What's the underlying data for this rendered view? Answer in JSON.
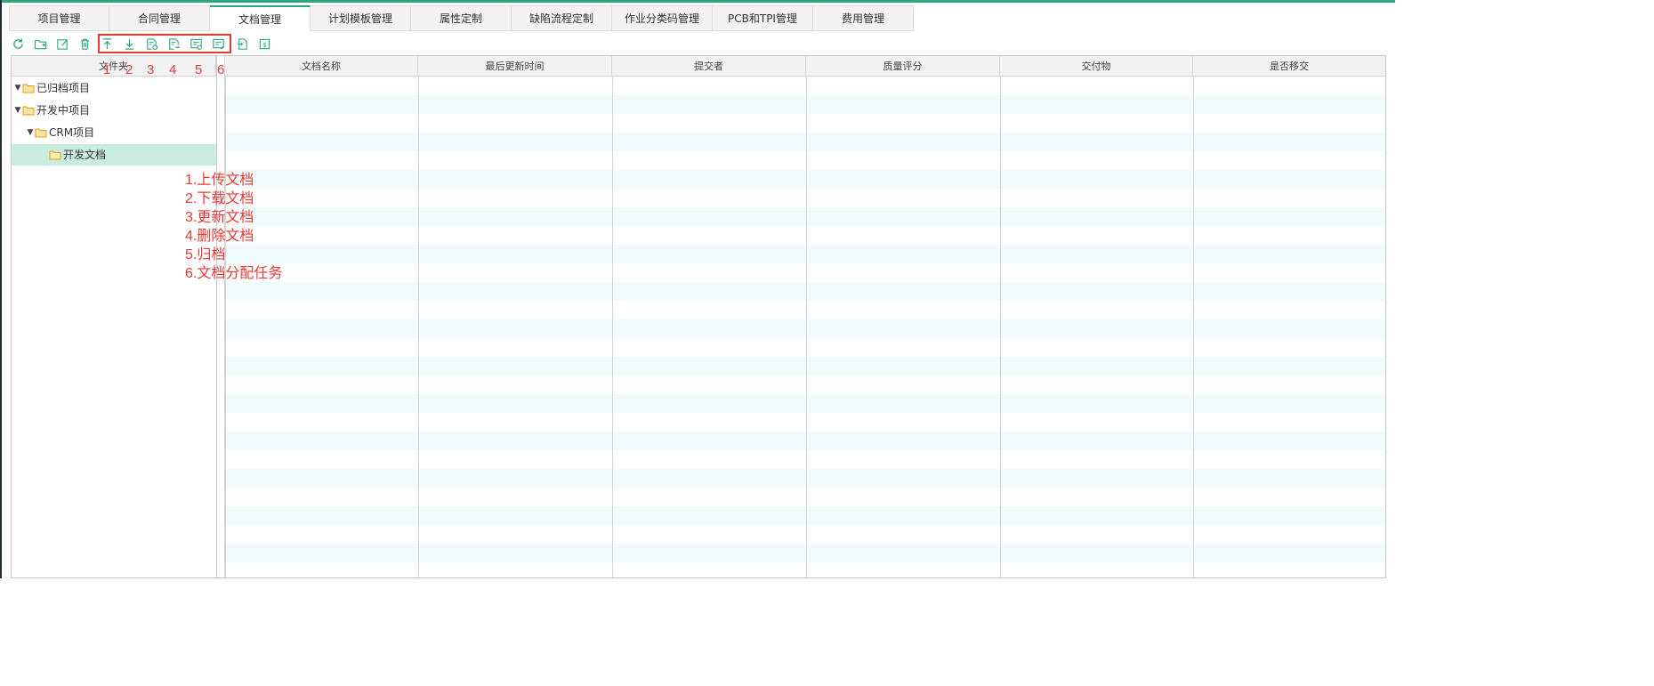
{
  "tabs": [
    {
      "label": "项目管理"
    },
    {
      "label": "合同管理"
    },
    {
      "label": "文档管理",
      "active": true
    },
    {
      "label": "计划模板管理"
    },
    {
      "label": "属性定制"
    },
    {
      "label": "缺陷流程定制"
    },
    {
      "label": "作业分类码管理"
    },
    {
      "label": "PCB和TPI管理"
    },
    {
      "label": "费用管理"
    }
  ],
  "toolbar_icons": [
    "refresh-icon",
    "add-folder-icon",
    "edit-icon",
    "delete-icon",
    "upload-icon",
    "download-icon",
    "update-doc-icon",
    "remove-doc-icon",
    "archive-icon",
    "assign-task-icon",
    "export-icon",
    "cost-icon"
  ],
  "tree": {
    "header": "文件夹",
    "nodes": [
      {
        "label": "已归档项目",
        "level": 0,
        "expanded": true
      },
      {
        "label": "开发中项目",
        "level": 0,
        "expanded": true
      },
      {
        "label": "CRM项目",
        "level": 1,
        "expanded": true
      },
      {
        "label": "开发文档",
        "level": 2,
        "selected": true
      }
    ]
  },
  "grid": {
    "columns": [
      "文档名称",
      "最后更新时间",
      "提交者",
      "质量评分",
      "交付物",
      "是否移交"
    ]
  },
  "annotations": {
    "numbers": [
      "1",
      "2",
      "3",
      "4",
      "5",
      "6"
    ],
    "legend": [
      "1.上传文档",
      "2.下载文档",
      "3.更新文档",
      "4.删除文档",
      "5.归档",
      "6.文档分配任务"
    ]
  },
  "colors": {
    "accent": "#2ea67f",
    "annotation": "#e53935",
    "stripe": "#f0fcfc",
    "selected": "#c9ecdf",
    "folder": "#f5c243"
  }
}
